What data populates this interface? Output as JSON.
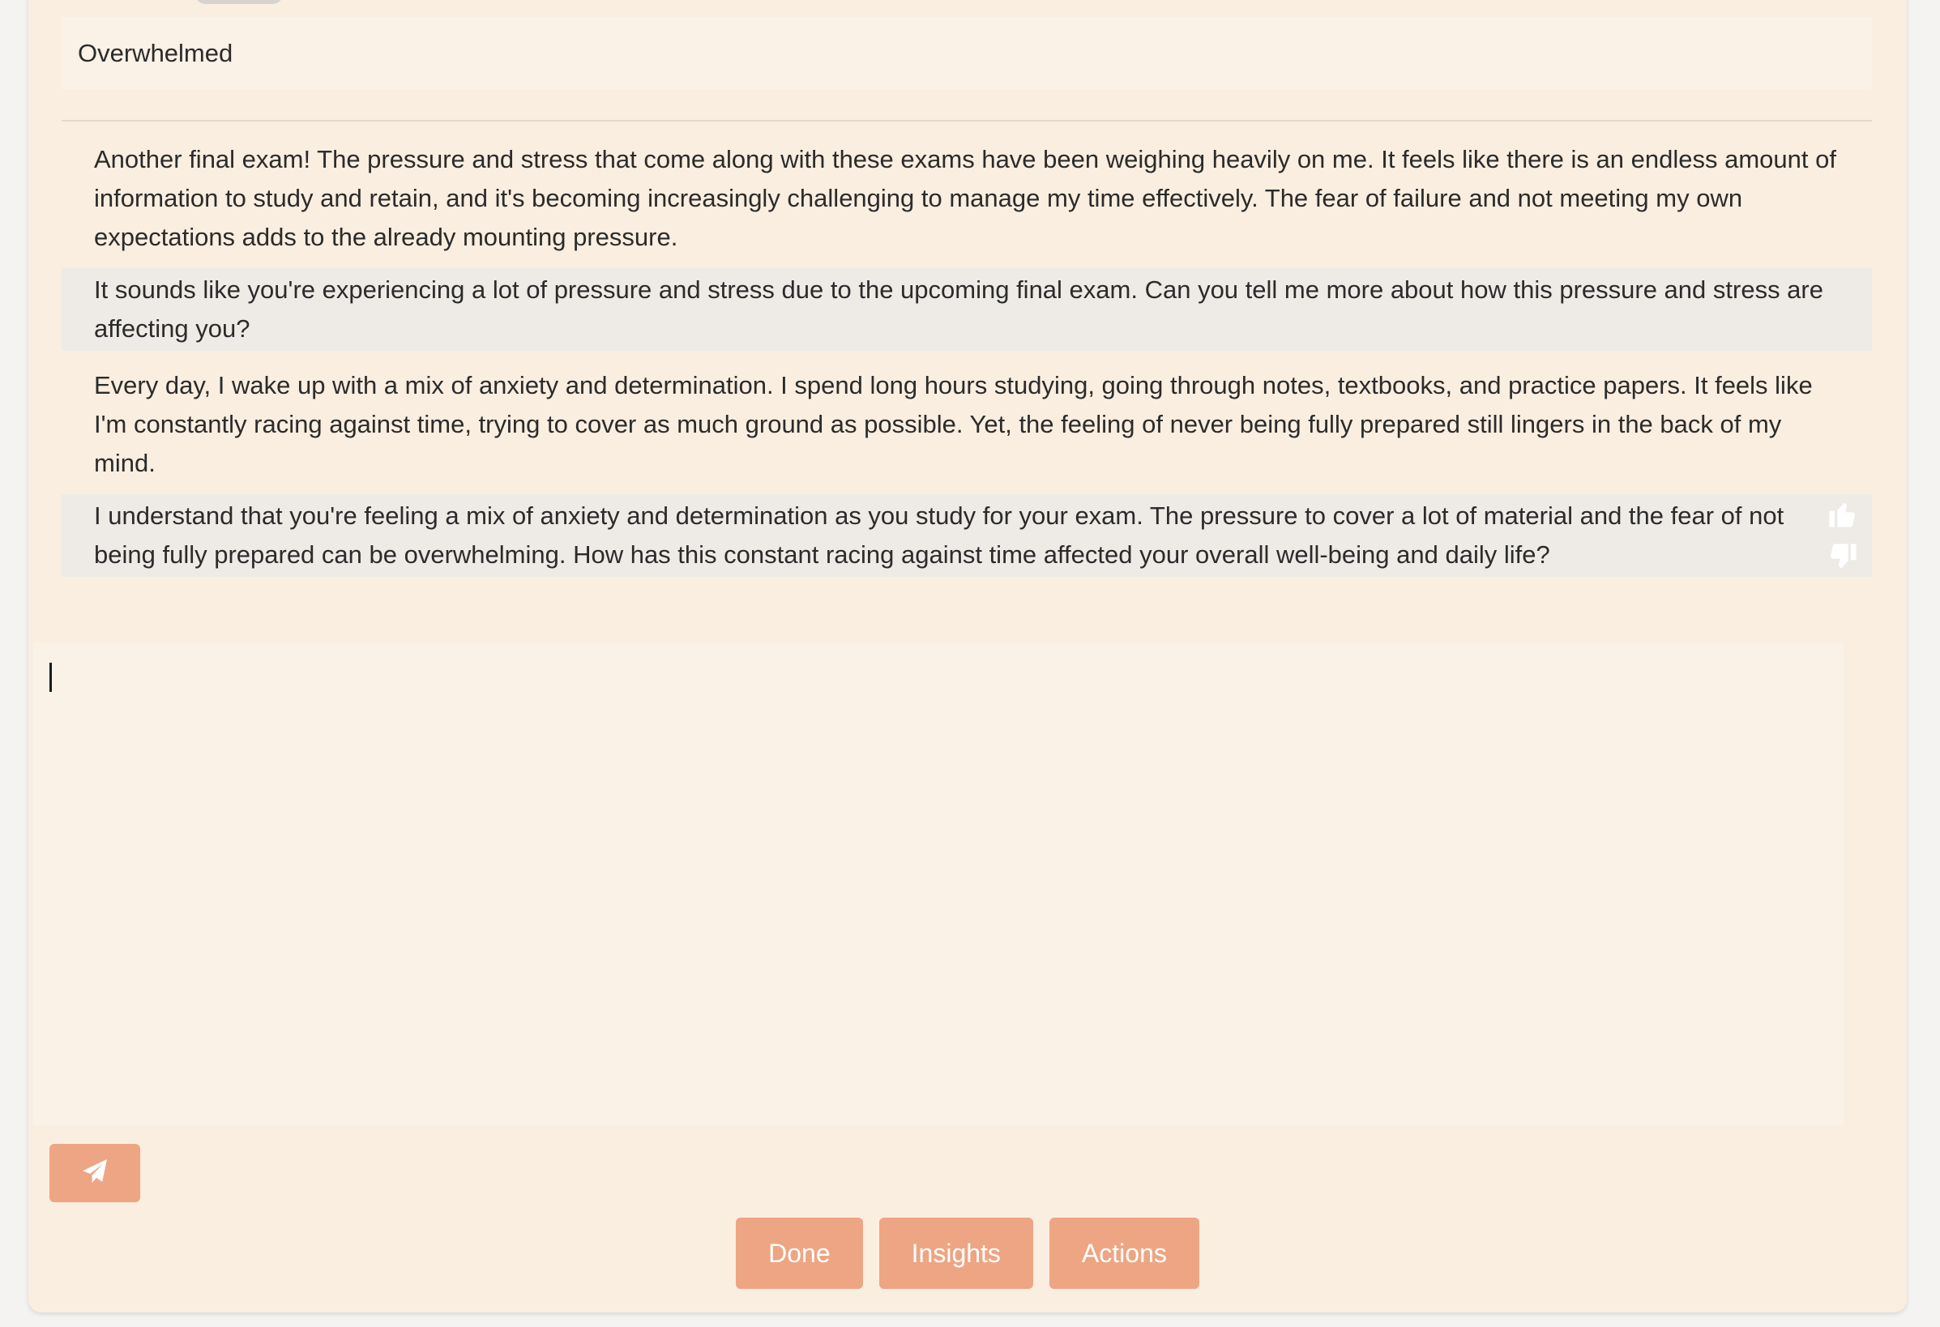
{
  "mood": {
    "value": "Overwhelmed"
  },
  "conversation": {
    "messages": [
      {
        "role": "user",
        "text": "Another final exam! The pressure and stress that come along with these exams have been weighing heavily on me. It feels like there is an endless amount of information to study and retain, and it's becoming increasingly challenging to manage my time effectively. The fear of failure and not meeting my own expectations adds to the already mounting pressure."
      },
      {
        "role": "assistant",
        "text": "It sounds like you're experiencing a lot of pressure and stress due to the upcoming final exam. Can you tell me more about how this pressure and stress are affecting you?"
      },
      {
        "role": "user",
        "text": "Every day, I wake up with a mix of anxiety and determination. I spend long hours studying, going through notes, textbooks, and practice papers. It feels like I'm constantly racing against time, trying to cover as much ground as possible. Yet, the feeling of never being fully prepared still lingers in the back of my mind."
      },
      {
        "role": "assistant",
        "text": "I understand that you're feeling a mix of anxiety and determination as you study for your exam. The pressure to cover a lot of material and the fear of not being fully prepared can be overwhelming. How has this constant racing against time affected your overall well-being and daily life?"
      }
    ]
  },
  "feedback": {
    "like_icon": "thumbs-up-icon",
    "dislike_icon": "thumbs-down-icon"
  },
  "reply": {
    "value": "",
    "placeholder": ""
  },
  "send": {
    "icon": "paper-plane-icon"
  },
  "actions": {
    "done_label": "Done",
    "insights_label": "Insights",
    "actions_label": "Actions"
  },
  "colors": {
    "accent": "#eea583",
    "card_background": "#faeee0",
    "assistant_bubble": "#eeeae6",
    "field_background": "#faf1e7"
  }
}
